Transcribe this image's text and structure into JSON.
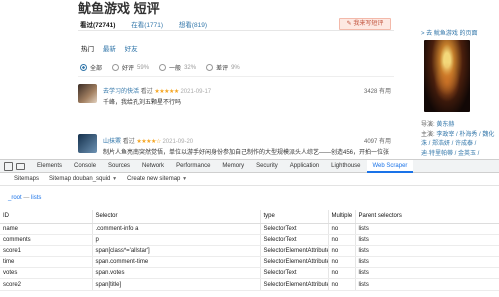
{
  "page": {
    "title": "鱿鱼游戏 短评",
    "tabs": [
      {
        "label": "看过(72741)"
      },
      {
        "label": "在看(1771)"
      },
      {
        "label": "想看(819)"
      }
    ],
    "write_button": "✎ 我来写短评",
    "subnav": [
      "热门",
      "最新",
      "好友"
    ],
    "filters": [
      {
        "label": "全部",
        "pct": ""
      },
      {
        "label": "好评",
        "pct": "59%"
      },
      {
        "label": "一般",
        "pct": "32%"
      },
      {
        "label": "差评",
        "pct": "9%"
      }
    ],
    "reviews": [
      {
        "user": "去学习的快活",
        "status": "看过",
        "stars": "★★★★★",
        "time": "2021-09-17",
        "useful": "3428 有用",
        "text": "千峰，我给孔刘五颗星不行吗"
      },
      {
        "user": "山抹罴",
        "status": "看过",
        "stars": "★★★★☆",
        "time": "2021-09-20",
        "useful": "4097 有用",
        "text": "制片人鱼亮南突然觉悟，单位以游手好闲身份参加自己制作的大型规模派头人综艺——创造456，开拍一位张"
      }
    ]
  },
  "sidebar": {
    "link": "> 去 鱿鱼游戏 的页面",
    "director_label": "导演:",
    "director": "黄东赫",
    "cast_label": "主演:",
    "cast_lines": [
      "李政宰 / 朴海秀 / 魏化",
      "洙 / 郑浩妍 / 许成泰 /",
      "迪·特里帕蒂 / 金英玉 /"
    ]
  },
  "devtools": {
    "tabs": [
      "Elements",
      "Console",
      "Sources",
      "Network",
      "Performance",
      "Memory",
      "Security",
      "Application",
      "Lighthouse",
      "Web Scraper"
    ],
    "active_tab": "Web Scraper",
    "scraper_bar": [
      "Sitemaps",
      "Sitemap douban_squid",
      "Create new sitemap"
    ],
    "breadcrumb": [
      "_root",
      "lists"
    ],
    "columns": [
      "ID",
      "Selector",
      "type",
      "Multiple",
      "Parent selectors"
    ],
    "rows": [
      [
        "name",
        ".comment-info a",
        "SelectorText",
        "no",
        "lists"
      ],
      [
        "comments",
        "p",
        "SelectorText",
        "no",
        "lists"
      ],
      [
        "score1",
        "span[class*='allstar']",
        "SelectorElementAttribute",
        "no",
        "lists"
      ],
      [
        "time",
        "span.comment-time",
        "SelectorElementAttribute",
        "no",
        "lists"
      ],
      [
        "votes",
        "span.votes",
        "SelectorText",
        "no",
        "lists"
      ],
      [
        "score2",
        "span[title]",
        "SelectorElementAttribute",
        "no",
        "lists"
      ]
    ]
  },
  "colors": {
    "link": "#3377aa",
    "star": "#f5a623",
    "devtools_accent": "#1a73e8"
  }
}
